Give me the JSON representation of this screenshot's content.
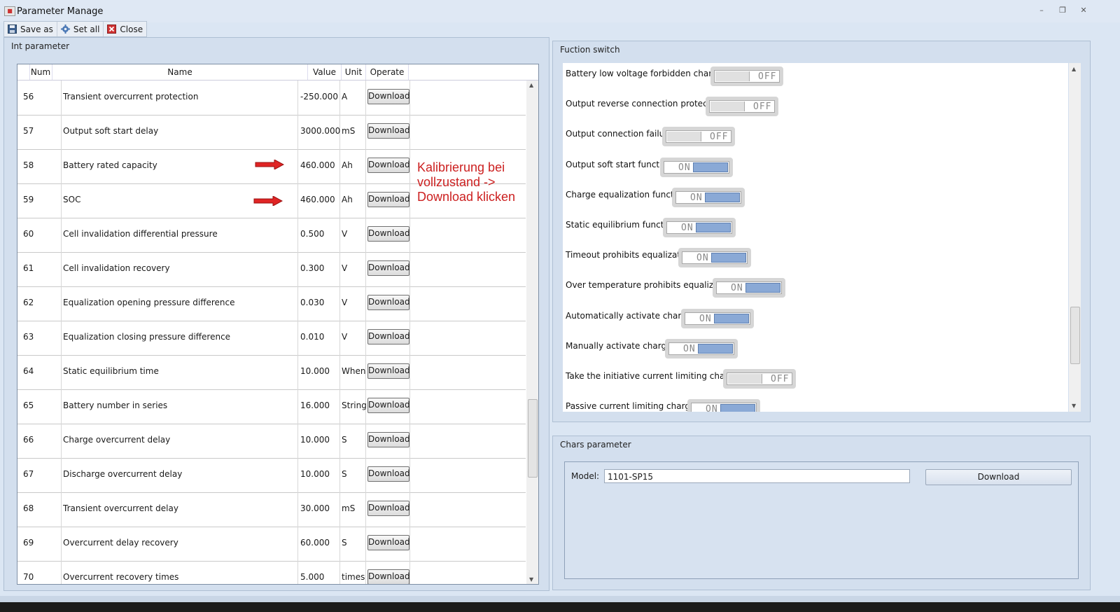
{
  "window": {
    "title": "Parameter Manage",
    "minimize": "–",
    "restore": "❐",
    "close": "✕"
  },
  "toolbar": {
    "items": [
      {
        "label": "Save as",
        "icon": "save-icon"
      },
      {
        "label": "Set all",
        "icon": "gear-icon"
      },
      {
        "label": "Close",
        "icon": "close-icon"
      }
    ]
  },
  "int_parameter": {
    "title": "Int parameter",
    "columns": {
      "num": "Num",
      "name": "Name",
      "value": "Value",
      "unit": "Unit",
      "operate": "Operate"
    },
    "rows": [
      {
        "num": "56",
        "name": "Transient overcurrent protection",
        "value": "-250.000",
        "unit": "A",
        "action": "Download"
      },
      {
        "num": "57",
        "name": "Output soft start delay",
        "value": "3000.000",
        "unit": "mS",
        "action": "Download"
      },
      {
        "num": "58",
        "name": "Battery rated capacity",
        "value": "460.000",
        "unit": "Ah",
        "action": "Download"
      },
      {
        "num": "59",
        "name": "SOC",
        "value": "460.000",
        "unit": "Ah",
        "action": "Download"
      },
      {
        "num": "60",
        "name": "Cell invalidation differential pressure",
        "value": "0.500",
        "unit": "V",
        "action": "Download"
      },
      {
        "num": "61",
        "name": "Cell invalidation recovery",
        "value": "0.300",
        "unit": "V",
        "action": "Download"
      },
      {
        "num": "62",
        "name": "Equalization opening pressure difference",
        "value": "0.030",
        "unit": "V",
        "action": "Download"
      },
      {
        "num": "63",
        "name": "Equalization closing pressure difference",
        "value": "0.010",
        "unit": "V",
        "action": "Download"
      },
      {
        "num": "64",
        "name": "Static equilibrium time",
        "value": "10.000",
        "unit": "When",
        "action": "Download"
      },
      {
        "num": "65",
        "name": "Battery number in series",
        "value": "16.000",
        "unit": "String",
        "action": "Download"
      },
      {
        "num": "66",
        "name": "Charge overcurrent delay",
        "value": "10.000",
        "unit": "S",
        "action": "Download"
      },
      {
        "num": "67",
        "name": "Discharge overcurrent delay",
        "value": "10.000",
        "unit": "S",
        "action": "Download"
      },
      {
        "num": "68",
        "name": "Transient overcurrent delay",
        "value": "30.000",
        "unit": "mS",
        "action": "Download"
      },
      {
        "num": "69",
        "name": "Overcurrent delay recovery",
        "value": "60.000",
        "unit": "S",
        "action": "Download"
      },
      {
        "num": "70",
        "name": "Overcurrent recovery times",
        "value": "5.000",
        "unit": "times",
        "action": "Download"
      }
    ],
    "annotation": "Kalibrierung bei\nvollzustand ->\nDownload klicken"
  },
  "function_switch": {
    "title": "Fuction switch",
    "on_text": "ON",
    "off_text": "OFF",
    "items": [
      {
        "label": "Battery low voltage forbidden charging",
        "state": "OFF"
      },
      {
        "label": "Output reverse connection protection",
        "state": "OFF"
      },
      {
        "label": "Output connection failure",
        "state": "OFF"
      },
      {
        "label": "Output soft start function",
        "state": "ON"
      },
      {
        "label": "Charge equalization function",
        "state": "ON"
      },
      {
        "label": "Static equilibrium function",
        "state": "ON"
      },
      {
        "label": "Timeout prohibits equalization",
        "state": "ON"
      },
      {
        "label": "Over temperature prohibits equalization",
        "state": "ON"
      },
      {
        "label": "Automatically activate charging",
        "state": "ON"
      },
      {
        "label": "Manually activate charging",
        "state": "ON"
      },
      {
        "label": "Take the initiative current limiting charging",
        "state": "OFF"
      },
      {
        "label": "Passive current limiting charging",
        "state": "ON"
      }
    ]
  },
  "chars_parameter": {
    "title": "Chars parameter",
    "model_label": "Model:",
    "model_value": "1101-SP15",
    "download_label": "Download"
  },
  "colors": {
    "annotation": "#cc2020",
    "toggle_on": "#8aa9d6",
    "panel_bg": "#d3dfee"
  }
}
